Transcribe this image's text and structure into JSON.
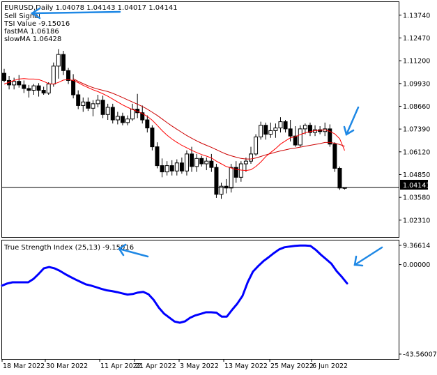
{
  "header": {
    "symbol_line": "EURUSD,Daily  1.04078 1.04143 1.04017 1.04141",
    "signal": "Sell Signal",
    "tsi_value": "TSI Value -9.15016",
    "fast_ma": "fastMA 1.06186",
    "slow_ma": "slowMA 1.06428"
  },
  "indicator_label": "True Strength Index (25,13) -9.15016",
  "price_tag": "1.04141",
  "colors": {
    "bull": "#ffffff",
    "bear": "#000000",
    "fast_ma": "#ff0000",
    "slow_ma": "#cc0000",
    "tsi": "#0000ff",
    "arrow": "#1e88e5",
    "price_tag_bg": "#000000",
    "grid": "#000000"
  },
  "icons": [
    "annotation-arrow-icon"
  ],
  "chart_data": [
    {
      "type": "candlestick",
      "symbol": "EURUSD",
      "timeframe": "Daily",
      "yticks": [
        "1.13740",
        "1.12470",
        "1.11200",
        "1.09930",
        "1.08660",
        "1.07390",
        "1.06120",
        "1.04850",
        "1.03580",
        "1.02310"
      ],
      "ylim": [
        1.0137,
        1.1447
      ],
      "xticks": [
        "18 Mar 2022",
        "30 Mar 2022",
        "11 Apr 2022",
        "21 Apr 2022",
        "3 May 2022",
        "13 May 2022",
        "25 May 2022",
        "6 Jun 2022"
      ],
      "last_price": 1.04141,
      "candles": [
        {
          "o": 1.105,
          "h": 1.1075,
          "l": 1.1,
          "c": 1.101
        },
        {
          "o": 1.101,
          "h": 1.1035,
          "l": 1.096,
          "c": 1.0985
        },
        {
          "o": 1.0985,
          "h": 1.1025,
          "l": 1.096,
          "c": 1.1005
        },
        {
          "o": 1.1005,
          "h": 1.104,
          "l": 1.097,
          "c": 1.0985
        },
        {
          "o": 1.0985,
          "h": 1.101,
          "l": 1.094,
          "c": 1.0965
        },
        {
          "o": 1.0965,
          "h": 1.0985,
          "l": 1.0915,
          "c": 1.0955
        },
        {
          "o": 1.0955,
          "h": 1.099,
          "l": 1.093,
          "c": 1.098
        },
        {
          "o": 1.098,
          "h": 1.0995,
          "l": 1.092,
          "c": 1.0955
        },
        {
          "o": 1.0955,
          "h": 1.0975,
          "l": 1.093,
          "c": 1.094
        },
        {
          "o": 1.094,
          "h": 1.1,
          "l": 1.093,
          "c": 1.099
        },
        {
          "o": 1.099,
          "h": 1.111,
          "l": 1.0975,
          "c": 1.109
        },
        {
          "o": 1.109,
          "h": 1.1185,
          "l": 1.102,
          "c": 1.1155
        },
        {
          "o": 1.1155,
          "h": 1.1175,
          "l": 1.104,
          "c": 1.1065
        },
        {
          "o": 1.1065,
          "h": 1.108,
          "l": 1.099,
          "c": 1.101
        },
        {
          "o": 1.101,
          "h": 1.1045,
          "l": 1.091,
          "c": 1.093
        },
        {
          "o": 1.093,
          "h": 1.0955,
          "l": 1.085,
          "c": 1.087
        },
        {
          "o": 1.087,
          "h": 1.0915,
          "l": 1.0835,
          "c": 1.089
        },
        {
          "o": 1.089,
          "h": 1.0915,
          "l": 1.084,
          "c": 1.0855
        },
        {
          "o": 1.0855,
          "h": 1.09,
          "l": 1.081,
          "c": 1.088
        },
        {
          "o": 1.088,
          "h": 1.093,
          "l": 1.086,
          "c": 1.09
        },
        {
          "o": 1.09,
          "h": 1.0925,
          "l": 1.08,
          "c": 1.082
        },
        {
          "o": 1.082,
          "h": 1.088,
          "l": 1.079,
          "c": 1.086
        },
        {
          "o": 1.086,
          "h": 1.088,
          "l": 1.077,
          "c": 1.079
        },
        {
          "o": 1.079,
          "h": 1.0835,
          "l": 1.0765,
          "c": 1.081
        },
        {
          "o": 1.081,
          "h": 1.083,
          "l": 1.076,
          "c": 1.0775
        },
        {
          "o": 1.0775,
          "h": 1.0815,
          "l": 1.076,
          "c": 1.0795
        },
        {
          "o": 1.0795,
          "h": 1.088,
          "l": 1.0785,
          "c": 1.085
        },
        {
          "o": 1.085,
          "h": 1.0935,
          "l": 1.08,
          "c": 1.083
        },
        {
          "o": 1.083,
          "h": 1.087,
          "l": 1.077,
          "c": 1.079
        },
        {
          "o": 1.079,
          "h": 1.0815,
          "l": 1.072,
          "c": 1.0745
        },
        {
          "o": 1.0745,
          "h": 1.076,
          "l": 1.062,
          "c": 1.064
        },
        {
          "o": 1.064,
          "h": 1.0665,
          "l": 1.052,
          "c": 1.0535
        },
        {
          "o": 1.0535,
          "h": 1.0575,
          "l": 1.047,
          "c": 1.05
        },
        {
          "o": 1.05,
          "h": 1.056,
          "l": 1.048,
          "c": 1.0535
        },
        {
          "o": 1.0535,
          "h": 1.0565,
          "l": 1.048,
          "c": 1.0505
        },
        {
          "o": 1.0505,
          "h": 1.057,
          "l": 1.048,
          "c": 1.055
        },
        {
          "o": 1.055,
          "h": 1.058,
          "l": 1.049,
          "c": 1.0505
        },
        {
          "o": 1.0505,
          "h": 1.062,
          "l": 1.048,
          "c": 1.06
        },
        {
          "o": 1.06,
          "h": 1.064,
          "l": 1.05,
          "c": 1.053
        },
        {
          "o": 1.053,
          "h": 1.06,
          "l": 1.05,
          "c": 1.0575
        },
        {
          "o": 1.0575,
          "h": 1.059,
          "l": 1.053,
          "c": 1.0545
        },
        {
          "o": 1.0545,
          "h": 1.058,
          "l": 1.051,
          "c": 1.056
        },
        {
          "o": 1.056,
          "h": 1.06,
          "l": 1.05,
          "c": 1.0525
        },
        {
          "o": 1.0525,
          "h": 1.0545,
          "l": 1.0355,
          "c": 1.0375
        },
        {
          "o": 1.0375,
          "h": 1.044,
          "l": 1.035,
          "c": 1.042
        },
        {
          "o": 1.042,
          "h": 1.046,
          "l": 1.038,
          "c": 1.041
        },
        {
          "o": 1.041,
          "h": 1.0545,
          "l": 1.0385,
          "c": 1.0525
        },
        {
          "o": 1.0525,
          "h": 1.056,
          "l": 1.044,
          "c": 1.047
        },
        {
          "o": 1.047,
          "h": 1.056,
          "l": 1.0445,
          "c": 1.0545
        },
        {
          "o": 1.0545,
          "h": 1.058,
          "l": 1.05,
          "c": 1.056
        },
        {
          "o": 1.056,
          "h": 1.064,
          "l": 1.0545,
          "c": 1.06
        },
        {
          "o": 1.06,
          "h": 1.071,
          "l": 1.059,
          "c": 1.0695
        },
        {
          "o": 1.0695,
          "h": 1.078,
          "l": 1.068,
          "c": 1.076
        },
        {
          "o": 1.076,
          "h": 1.0775,
          "l": 1.068,
          "c": 1.071
        },
        {
          "o": 1.071,
          "h": 1.0775,
          "l": 1.069,
          "c": 1.073
        },
        {
          "o": 1.073,
          "h": 1.077,
          "l": 1.069,
          "c": 1.0745
        },
        {
          "o": 1.0745,
          "h": 1.0805,
          "l": 1.072,
          "c": 1.078
        },
        {
          "o": 1.078,
          "h": 1.079,
          "l": 1.072,
          "c": 1.074
        },
        {
          "o": 1.074,
          "h": 1.079,
          "l": 1.067,
          "c": 1.07
        },
        {
          "o": 1.07,
          "h": 1.0755,
          "l": 1.064,
          "c": 1.065
        },
        {
          "o": 1.065,
          "h": 1.076,
          "l": 1.064,
          "c": 1.074
        },
        {
          "o": 1.074,
          "h": 1.077,
          "l": 1.071,
          "c": 1.076
        },
        {
          "o": 1.076,
          "h": 1.0775,
          "l": 1.07,
          "c": 1.072
        },
        {
          "o": 1.072,
          "h": 1.076,
          "l": 1.07,
          "c": 1.0735
        },
        {
          "o": 1.0735,
          "h": 1.0755,
          "l": 1.071,
          "c": 1.0725
        },
        {
          "o": 1.0725,
          "h": 1.0775,
          "l": 1.07,
          "c": 1.074
        },
        {
          "o": 1.074,
          "h": 1.0765,
          "l": 1.064,
          "c": 1.0655
        },
        {
          "o": 1.0655,
          "h": 1.0665,
          "l": 1.05,
          "c": 1.052
        },
        {
          "o": 1.052,
          "h": 1.053,
          "l": 1.04,
          "c": 1.041
        },
        {
          "o": 1.0408,
          "h": 1.0414,
          "l": 1.0402,
          "c": 1.0414
        }
      ],
      "series": [
        {
          "name": "fastMA",
          "values": [
            1.099,
            1.1,
            1.101,
            1.1018,
            1.102,
            1.1018,
            1.1018,
            1.1015,
            1.1005,
            1.0992,
            1.099,
            1.0999,
            1.1012,
            1.1015,
            1.101,
            1.0998,
            1.0983,
            1.097,
            1.0958,
            1.0948,
            1.0936,
            1.0922,
            1.0906,
            1.089,
            1.0874,
            1.086,
            1.0848,
            1.0838,
            1.0826,
            1.081,
            1.0788,
            1.076,
            1.073,
            1.0705,
            1.0683,
            1.0665,
            1.0648,
            1.0634,
            1.062,
            1.0608,
            1.0597,
            1.0588,
            1.0578,
            1.056,
            1.0545,
            1.053,
            1.0522,
            1.0514,
            1.051,
            1.0508,
            1.0512,
            1.053,
            1.0555,
            1.0585,
            1.0608,
            1.063,
            1.0655,
            1.0673,
            1.069,
            1.0696,
            1.0708,
            1.0718,
            1.0725,
            1.073,
            1.0732,
            1.0735,
            1.0726,
            1.0712,
            1.0685,
            1.0619
          ]
        },
        {
          "name": "slowMA",
          "values": [
            null,
            null,
            null,
            null,
            null,
            null,
            null,
            null,
            null,
            null,
            null,
            null,
            null,
            null,
            1.102,
            1.1005,
            1.0992,
            1.098,
            1.097,
            1.0962,
            1.0955,
            1.0948,
            1.0938,
            1.0927,
            1.0915,
            1.0902,
            1.089,
            1.0877,
            1.0865,
            1.085,
            1.0833,
            1.0815,
            1.0795,
            1.0775,
            1.0756,
            1.0738,
            1.072,
            1.0703,
            1.0688,
            1.0673,
            1.066,
            1.0648,
            1.0637,
            1.0624,
            1.0611,
            1.0599,
            1.059,
            1.0582,
            1.0575,
            1.0572,
            1.0572,
            1.0578,
            1.0586,
            1.0595,
            1.0602,
            1.061,
            1.0617,
            1.0623,
            1.0629,
            1.0633,
            1.0638,
            1.0643,
            1.0648,
            1.0653,
            1.0658,
            1.0664,
            1.0664,
            1.066,
            1.0653,
            1.0643
          ]
        }
      ]
    },
    {
      "type": "line",
      "title": "True Strength Index (25,13) -9.15016",
      "yticks": [
        "9.36614",
        "0.00000",
        "-43.56007"
      ],
      "ylim": [
        -43.56007,
        9.36614
      ],
      "series": [
        {
          "name": "True Strength Index (25,13)",
          "values": [
            -10.2,
            -9.2,
            -8.6,
            -8.6,
            -8.6,
            -8.6,
            -7.0,
            -4.5,
            -1.8,
            -1.2,
            -1.8,
            -3.0,
            -4.5,
            -5.9,
            -7.2,
            -8.4,
            -9.6,
            -10.2,
            -11.0,
            -11.8,
            -12.5,
            -12.9,
            -13.4,
            -14.0,
            -14.6,
            -14.3,
            -13.6,
            -13.3,
            -14.4,
            -17.2,
            -21.0,
            -23.9,
            -25.8,
            -27.7,
            -28.3,
            -27.6,
            -25.8,
            -24.7,
            -24.0,
            -23.2,
            -23.2,
            -23.4,
            -25.3,
            -25.3,
            -22.0,
            -19.0,
            -15.2,
            -8.5,
            -3.4,
            -0.7,
            1.7,
            3.6,
            5.6,
            7.4,
            8.4,
            8.8,
            9.1,
            9.3,
            9.3,
            9.1,
            7.2,
            4.8,
            2.6,
            0.4,
            -3.2,
            -6.0,
            -9.15
          ]
        }
      ]
    }
  ]
}
